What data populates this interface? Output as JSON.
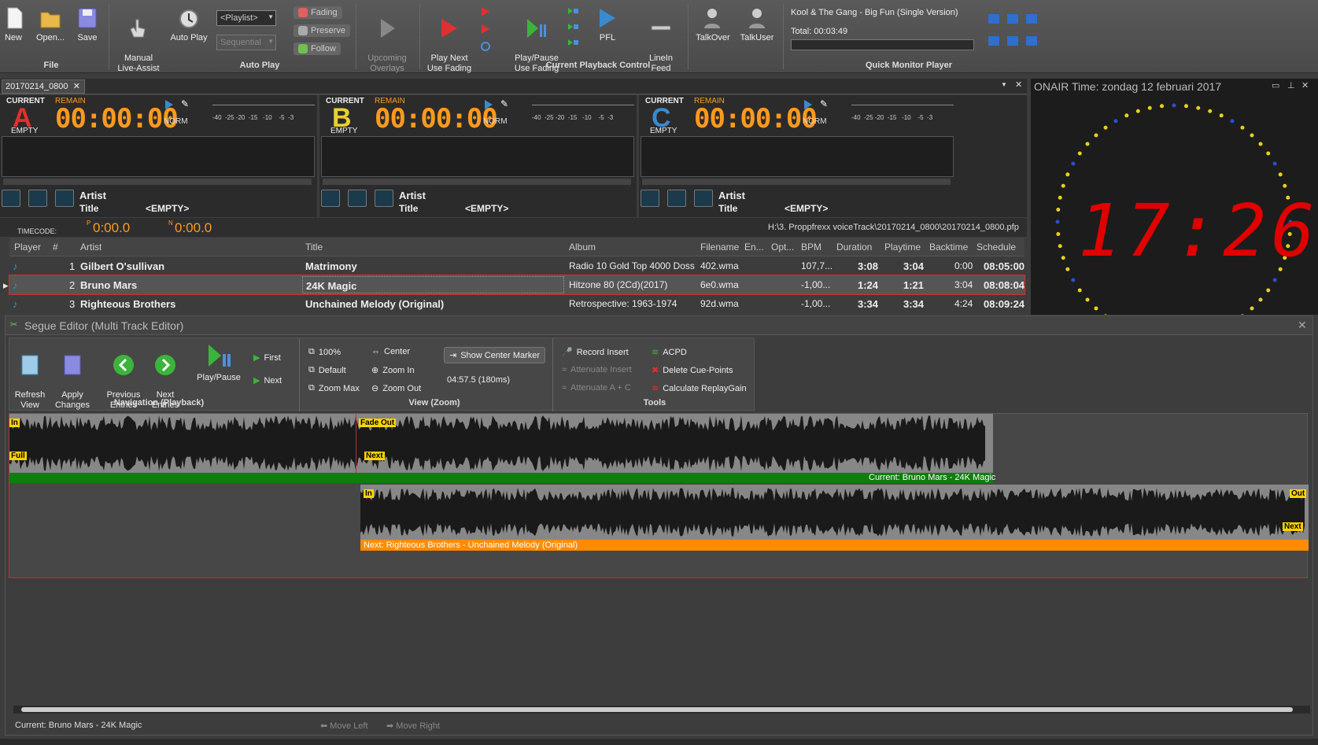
{
  "ribbon": {
    "new_label": "New",
    "open_label": "Open...",
    "save_label": "Save",
    "file_group": "File",
    "manual_label": "Manual\nLive-Assist",
    "autoplay_label": "Auto Play",
    "playlist_select": "<Playlist>",
    "sequential_select": "Sequential",
    "fading_label": "Fading",
    "preserve_label": "Preserve",
    "follow_label": "Follow",
    "upcoming_label": "Upcoming\nOverlays",
    "autoplay_group": "Auto Play",
    "playnext_label": "Play Next\nUse Fading",
    "playpause_label": "Play/Pause\nUse Fading",
    "pfl_label": "PFL",
    "linein_label": "LineIn\nFeed",
    "playback_group": "Current Playback Control",
    "talkover_label": "TalkOver",
    "talkuser_label": "TalkUser",
    "qmp_track": "Kool & The Gang - Big Fun (Single Version)",
    "qmp_total": "Total: 00:03:49",
    "qmp_group": "Quick Monitor Player"
  },
  "doc_tab": "20170214_0800",
  "onair_title": "ONAIR Time: zondag 12 februari 2017",
  "clock_text": "17:26",
  "players": [
    {
      "letter": "A",
      "current": "CURRENT",
      "remain": "REMAIN",
      "time": "00:00:00",
      "status": "EMPTY",
      "norm": "NORM",
      "artist": "Artist",
      "title": "Title",
      "title_value": "<EMPTY>"
    },
    {
      "letter": "B",
      "current": "CURRENT",
      "remain": "REMAIN",
      "time": "00:00:00",
      "status": "EMPTY",
      "norm": "NORM",
      "artist": "Artist",
      "title": "Title",
      "title_value": "<EMPTY>"
    },
    {
      "letter": "C",
      "current": "CURRENT",
      "remain": "REMAIN",
      "time": "00:00:00",
      "status": "EMPTY",
      "norm": "NORM",
      "artist": "Artist",
      "title": "Title",
      "title_value": "<EMPTY>"
    }
  ],
  "meter_scale": "-40  -25 -20  -15   -10    -5  -3",
  "timecode": {
    "label": "TIMECODE:",
    "p_value": "0:00.0",
    "n_value": "0:00.0",
    "path": "H:\\3. Proppfrexx voiceTrack\\20170214_0800\\20170214_0800.pfp"
  },
  "table": {
    "headers": [
      "Player",
      "#",
      "Artist",
      "Title",
      "Album",
      "Filename",
      "En...",
      "Opt...",
      "BPM",
      "Duration",
      "Playtime",
      "Backtime",
      "Schedule"
    ],
    "rows": [
      {
        "num": "1",
        "artist": "Gilbert O'sullivan",
        "title": "Matrimony",
        "album": "Radio 10 Gold Top 4000 Doss...",
        "filename": "402.wma",
        "bpm": "107,7...",
        "duration": "3:08",
        "playtime": "3:04",
        "backtime": "0:00",
        "schedule": "08:05:00"
      },
      {
        "num": "2",
        "artist": "Bruno Mars",
        "title": "24K Magic",
        "album": "Hitzone 80 (2Cd)(2017)",
        "filename": "6e0.wma",
        "bpm": "-1,00...",
        "duration": "1:24",
        "playtime": "1:21",
        "backtime": "3:04",
        "schedule": "08:08:04"
      },
      {
        "num": "3",
        "artist": "Righteous Brothers",
        "title": "Unchained Melody (Original)",
        "album": "Retrospective: 1963-1974",
        "filename": "92d.wma",
        "bpm": "-1,00...",
        "duration": "3:34",
        "playtime": "3:34",
        "backtime": "4:24",
        "schedule": "08:09:24"
      }
    ]
  },
  "segue": {
    "title": "Segue Editor (Multi Track Editor)",
    "refresh": "Refresh\nView",
    "apply": "Apply\nChanges",
    "prev": "Previous\nEntries",
    "next_entries": "Next\nEntries",
    "playpause": "Play/Pause",
    "first": "First",
    "next": "Next",
    "nav_group": "Navigation (Playback)",
    "z100": "100%",
    "zdefault": "Default",
    "zmax": "Zoom Max",
    "center": "Center",
    "zin": "Zoom In",
    "zout": "Zoom Out",
    "show_center": "Show Center Marker",
    "pos": "04:57.5 (180ms)",
    "view_group": "View (Zoom)",
    "record_insert": "Record Insert",
    "attenuate_insert": "Attenuate Insert",
    "attenuate_ac": "Attenuate A + C",
    "acpd": "ACPD",
    "delete_cue": "Delete Cue-Points",
    "calc_rg": "Calculate ReplayGain",
    "tools_group": "Tools",
    "cue_in": "In",
    "cue_full": "Full",
    "cue_fade": "Fade",
    "cue_out": "Out",
    "cue_next": "Next",
    "current_track": "Current: Bruno Mars - 24K Magic",
    "next_track": "Next: Righteous Brothers - Unchained Melody (Original)",
    "footer_current": "Current: Bruno Mars - 24K Magic",
    "move_left": "Move Left",
    "move_right": "Move Right"
  },
  "colors": {
    "accent_orange": "#ff9a1c",
    "green_bar": "#0f7d0f",
    "next_bar": "#ff8c00",
    "clock_red": "#e00000"
  }
}
